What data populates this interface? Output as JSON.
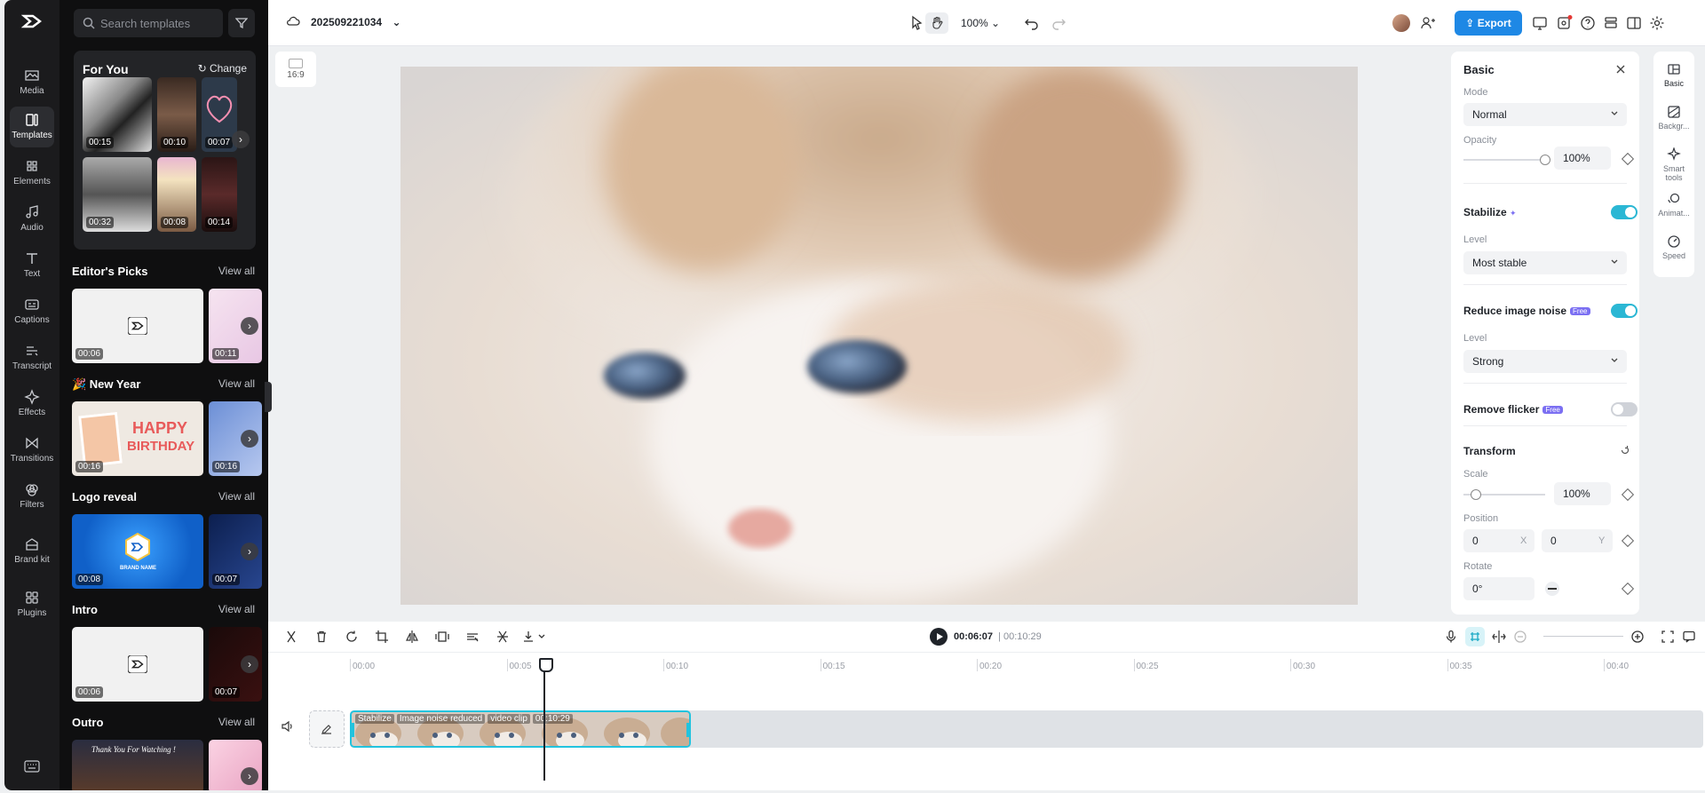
{
  "rail": {
    "items": [
      {
        "label": "Media",
        "icon": "media-icon"
      },
      {
        "label": "Templates",
        "icon": "templates-icon",
        "active": true
      },
      {
        "label": "Elements",
        "icon": "elements-icon"
      },
      {
        "label": "Audio",
        "icon": "audio-icon"
      },
      {
        "label": "Text",
        "icon": "text-icon"
      },
      {
        "label": "Captions",
        "icon": "captions-icon"
      },
      {
        "label": "Transcript",
        "icon": "transcript-icon"
      },
      {
        "label": "Effects",
        "icon": "effects-icon"
      },
      {
        "label": "Transitions",
        "icon": "transitions-icon"
      },
      {
        "label": "Filters",
        "icon": "filters-icon"
      },
      {
        "label": "Brand kit",
        "icon": "brand-kit-icon"
      },
      {
        "label": "Plugins",
        "icon": "plugins-icon"
      }
    ]
  },
  "panel": {
    "search_placeholder": "Search templates",
    "for_you": {
      "title": "For You",
      "change": "Change",
      "durations": [
        "00:15",
        "00:10",
        "00:07",
        "00:32",
        "00:08",
        "00:14"
      ]
    },
    "sections": [
      {
        "title": "Editor's Picks",
        "view_all": "View all",
        "durations": [
          "00:06",
          "00:11"
        ]
      },
      {
        "title": "🎉 New Year",
        "view_all": "View all",
        "durations": [
          "00:16",
          "00:16"
        ]
      },
      {
        "title": "Logo reveal",
        "view_all": "View all",
        "durations": [
          "00:08",
          "00:07"
        ]
      },
      {
        "title": "Intro",
        "view_all": "View all",
        "durations": [
          "00:06",
          "00:07"
        ]
      },
      {
        "title": "Outro",
        "view_all": "View all",
        "durations": [
          "",
          ""
        ]
      }
    ],
    "thumb_texts": {
      "happy": "HAPPY",
      "birthday": "BIRTHDAY",
      "brand_name": "BRAND NAME",
      "thank_you": "Thank You For Watching !"
    }
  },
  "topbar": {
    "project_name": "202509221034",
    "zoom": "100%",
    "export": "Export"
  },
  "ratio": "16:9",
  "props": {
    "title": "Basic",
    "mode_label": "Mode",
    "mode_value": "Normal",
    "opacity_label": "Opacity",
    "opacity_value": "100%",
    "opacity_level": 1.0,
    "stabilize_label": "Stabilize",
    "stabilize_on": true,
    "stabilize_level_label": "Level",
    "stabilize_level_value": "Most stable",
    "noise_label": "Reduce image noise",
    "free_badge": "Free",
    "noise_on": true,
    "noise_level_label": "Level",
    "noise_level_value": "Strong",
    "flicker_label": "Remove flicker",
    "flicker_on": false,
    "transform_label": "Transform",
    "scale_label": "Scale",
    "scale_value": "100%",
    "scale_level": 0.0,
    "position_label": "Position",
    "pos_x": "0",
    "pos_y": "0",
    "axis_x": "X",
    "axis_y": "Y",
    "rotate_label": "Rotate",
    "rotate_value": "0°"
  },
  "right_tabs": [
    {
      "label": "Basic",
      "icon": "basic-icon"
    },
    {
      "label": "Backgr...",
      "icon": "background-icon"
    },
    {
      "label": "Smart tools",
      "icon": "smart-tools-icon"
    },
    {
      "label": "Animat...",
      "icon": "animation-icon"
    },
    {
      "label": "Speed",
      "icon": "speed-icon"
    }
  ],
  "timeline": {
    "current": "00:06:07",
    "total": "00:10:29",
    "ruler": [
      "00:00",
      "00:05",
      "00:10",
      "00:15",
      "00:20",
      "00:25",
      "00:30",
      "00:35",
      "00:40"
    ],
    "clip_tags": [
      "Stabilize",
      "Image noise reduced",
      "video clip",
      "00:10:29"
    ]
  },
  "colors": {
    "accent": "#2bb7d4",
    "export": "#1e88e5",
    "rail_bg": "#1b1b1d",
    "panel_bg": "#0f0f10"
  }
}
